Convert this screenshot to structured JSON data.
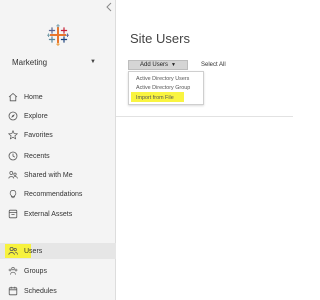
{
  "sidebar": {
    "collapse_icon": "chevron-left-icon",
    "site_name": "Marketing",
    "items": [
      {
        "label": "Home",
        "icon": "home-icon"
      },
      {
        "label": "Explore",
        "icon": "compass-icon"
      },
      {
        "label": "Favorites",
        "icon": "star-icon"
      },
      {
        "label": "Recents",
        "icon": "clock-icon"
      },
      {
        "label": "Shared with Me",
        "icon": "shared-users-icon"
      },
      {
        "label": "Recommendations",
        "icon": "lightbulb-icon"
      },
      {
        "label": "External Assets",
        "icon": "database-icon"
      },
      {
        "label": "Users",
        "icon": "users-icon",
        "selected": true,
        "highlighted": true
      },
      {
        "label": "Groups",
        "icon": "groups-icon"
      },
      {
        "label": "Schedules",
        "icon": "calendar-icon"
      }
    ]
  },
  "main": {
    "title": "Site Users",
    "add_users_label": "Add Users",
    "select_all_label": "Select All",
    "dropdown": {
      "items": [
        {
          "label": "Active Directory Users"
        },
        {
          "label": "Active Directory Group"
        },
        {
          "label": "Import from File",
          "highlighted": true
        }
      ]
    }
  },
  "colors": {
    "highlight": "#f8f32b",
    "sidebar_bg": "#f4f4f4",
    "button_bg": "#d5d5d5"
  }
}
